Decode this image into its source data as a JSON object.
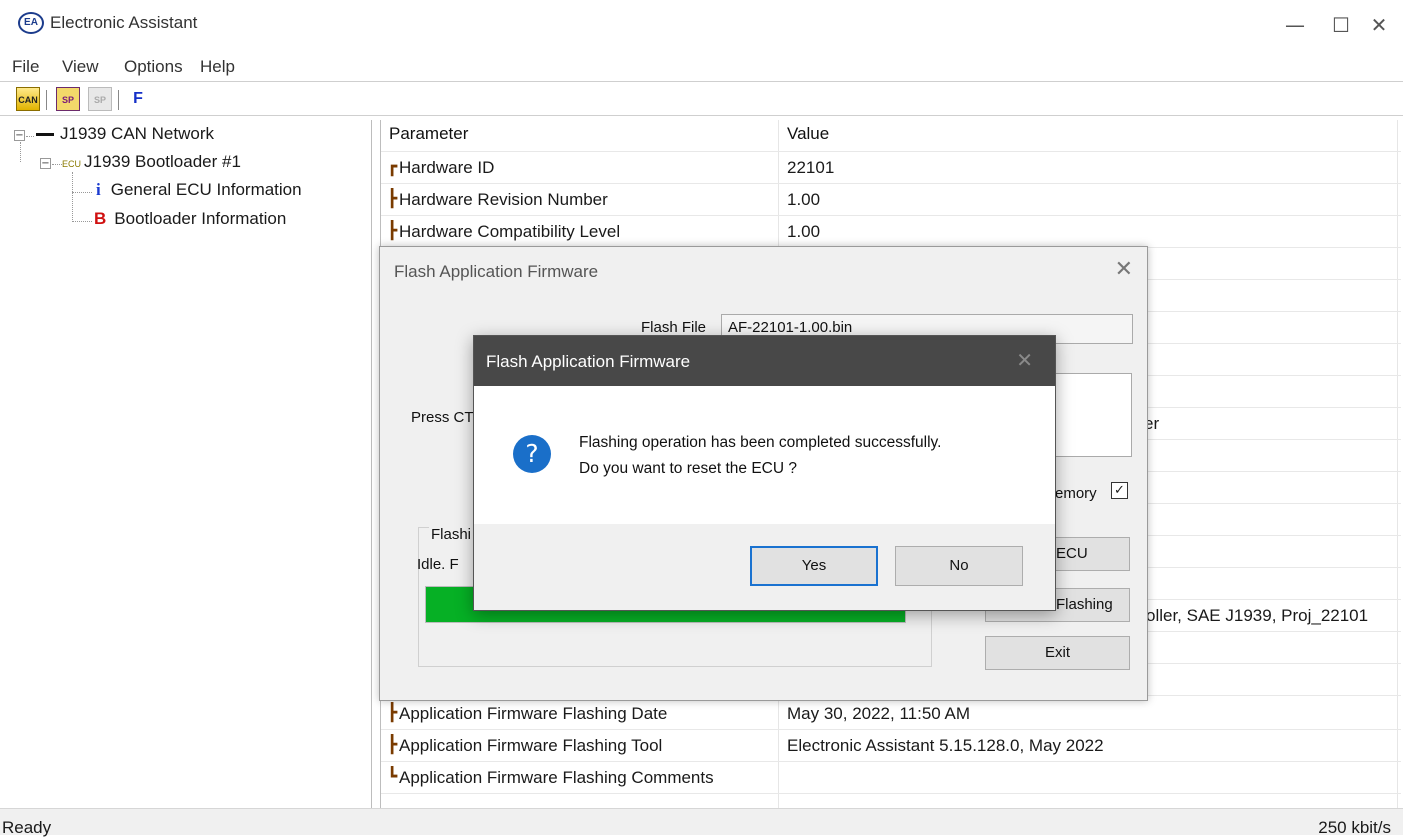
{
  "window": {
    "title": "Electronic Assistant",
    "icon_text": "EA",
    "controls": {
      "minimize": "—",
      "maximize": "☐",
      "close": "✕"
    }
  },
  "menu": [
    "File",
    "View",
    "Options",
    "Help"
  ],
  "toolbar": {
    "buttons": [
      {
        "name": "can-connect-icon",
        "text": "CAN"
      },
      {
        "name": "sp-icon",
        "text": "SP"
      },
      {
        "name": "sp-disabled-icon",
        "text": "SP"
      },
      {
        "name": "flash-icon",
        "text": "F"
      }
    ]
  },
  "tree": {
    "root": "J1939 CAN Network",
    "ecu_tag": "ECU",
    "ecu": "J1939 Bootloader #1",
    "items": [
      {
        "icon_text": "i",
        "label": "General ECU Information"
      },
      {
        "icon_text": "B",
        "label": "Bootloader Information"
      }
    ]
  },
  "list": {
    "headers": {
      "parameter": "Parameter",
      "value": "Value"
    },
    "rows_top": [
      {
        "glyph": "┏",
        "parameter": "Hardware ID",
        "value": "22101"
      },
      {
        "glyph": "┣",
        "parameter": "Hardware Revision Number",
        "value": "1.00"
      },
      {
        "glyph": "┣",
        "parameter": "Hardware Compatibility Level",
        "value": "1.00"
      }
    ],
    "partial_values": {
      "row6": "er",
      "row11": "oller, SAE J1939, Proj_22101"
    },
    "rows_bottom": [
      {
        "glyph": "┣",
        "parameter": "Application Firmware Flashing Date",
        "value": "May 30, 2022, 11:50 AM"
      },
      {
        "glyph": "┣",
        "parameter": "Application Firmware Flashing Tool",
        "value": "Electronic Assistant 5.15.128.0, May 2022"
      },
      {
        "glyph": "┗",
        "parameter": "Application Firmware Flashing Comments",
        "value": ""
      }
    ]
  },
  "status": {
    "left": "Ready",
    "right": "250 kbit/s"
  },
  "flash_dialog": {
    "title": "Flash Application Firmware",
    "close": "✕",
    "flash_file_label": "Flash File",
    "flash_file_value": "AF-22101-1.00.bin",
    "press_partial": "Press CT",
    "group_partial": "Flashi",
    "status_partial": "Idle. F",
    "progress_percent": 100,
    "memory_partial": "emory",
    "memory_checked": "✓",
    "btn_ecu_partial": "ECU",
    "btn_flashing_partial": "Flashing",
    "btn_exit": "Exit",
    "colors": {
      "progress": "#06b025"
    }
  },
  "message_box": {
    "title": "Flash Application Firmware",
    "close": "✕",
    "icon": "?",
    "line1": "Flashing operation has been completed successfully.",
    "line2": "Do you want to reset the ECU ?",
    "yes": "Yes",
    "no": "No",
    "colors": {
      "titlebar": "#484848",
      "icon": "#1a6fc9",
      "default_border": "#1a72d0"
    }
  }
}
